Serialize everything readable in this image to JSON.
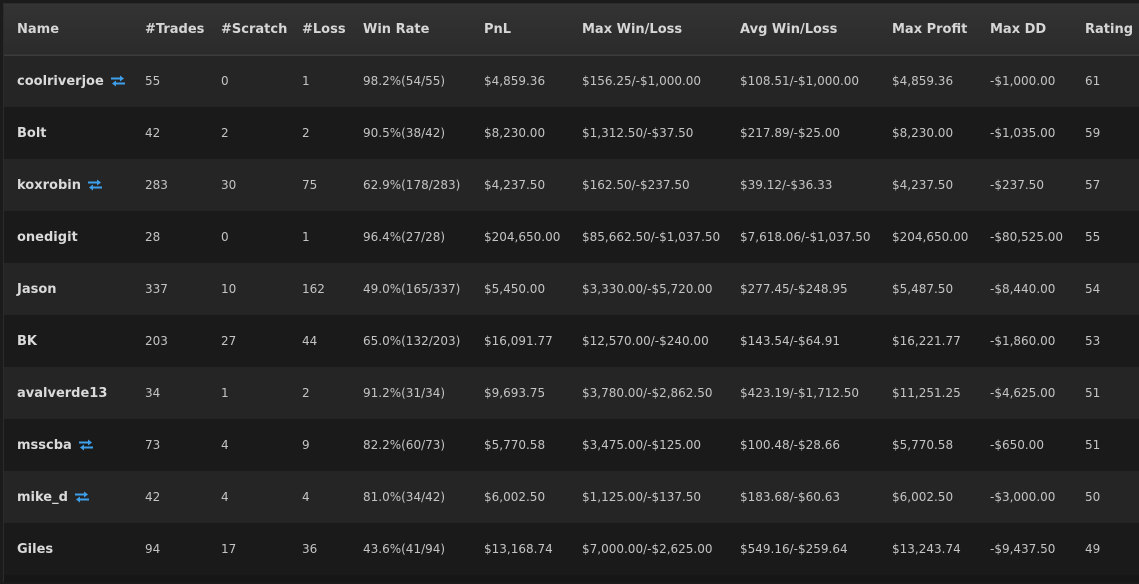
{
  "columns": [
    "Name",
    "#Trades",
    "#Scratch",
    "#Loss",
    "Win Rate",
    "PnL",
    "Max Win/Loss",
    "Avg Win/Loss",
    "Max Profit",
    "Max DD",
    "Rating"
  ],
  "rows": [
    {
      "name": "coolriverjoe",
      "swap": true,
      "trades": "55",
      "scratch": "0",
      "loss": "1",
      "win_rate": "98.2%(54/55)",
      "pnl": "$4,859.36",
      "max_win_loss": "$156.25/-$1,000.00",
      "avg_win_loss": "$108.51/-$1,000.00",
      "max_profit": "$4,859.36",
      "max_dd": "-$1,000.00",
      "rating": "61"
    },
    {
      "name": "Bolt",
      "swap": false,
      "trades": "42",
      "scratch": "2",
      "loss": "2",
      "win_rate": "90.5%(38/42)",
      "pnl": "$8,230.00",
      "max_win_loss": "$1,312.50/-$37.50",
      "avg_win_loss": "$217.89/-$25.00",
      "max_profit": "$8,230.00",
      "max_dd": "-$1,035.00",
      "rating": "59"
    },
    {
      "name": "koxrobin",
      "swap": true,
      "trades": "283",
      "scratch": "30",
      "loss": "75",
      "win_rate": "62.9%(178/283)",
      "pnl": "$4,237.50",
      "max_win_loss": "$162.50/-$237.50",
      "avg_win_loss": "$39.12/-$36.33",
      "max_profit": "$4,237.50",
      "max_dd": "-$237.50",
      "rating": "57"
    },
    {
      "name": "onedigit",
      "swap": false,
      "trades": "28",
      "scratch": "0",
      "loss": "1",
      "win_rate": "96.4%(27/28)",
      "pnl": "$204,650.00",
      "max_win_loss": "$85,662.50/-$1,037.50",
      "avg_win_loss": "$7,618.06/-$1,037.50",
      "max_profit": "$204,650.00",
      "max_dd": "-$80,525.00",
      "rating": "55"
    },
    {
      "name": "Jason",
      "swap": false,
      "trades": "337",
      "scratch": "10",
      "loss": "162",
      "win_rate": "49.0%(165/337)",
      "pnl": "$5,450.00",
      "max_win_loss": "$3,330.00/-$5,720.00",
      "avg_win_loss": "$277.45/-$248.95",
      "max_profit": "$5,487.50",
      "max_dd": "-$8,440.00",
      "rating": "54"
    },
    {
      "name": "BK",
      "swap": false,
      "trades": "203",
      "scratch": "27",
      "loss": "44",
      "win_rate": "65.0%(132/203)",
      "pnl": "$16,091.77",
      "max_win_loss": "$12,570.00/-$240.00",
      "avg_win_loss": "$143.54/-$64.91",
      "max_profit": "$16,221.77",
      "max_dd": "-$1,860.00",
      "rating": "53"
    },
    {
      "name": "avalverde13",
      "swap": false,
      "trades": "34",
      "scratch": "1",
      "loss": "2",
      "win_rate": "91.2%(31/34)",
      "pnl": "$9,693.75",
      "max_win_loss": "$3,780.00/-$2,862.50",
      "avg_win_loss": "$423.19/-$1,712.50",
      "max_profit": "$11,251.25",
      "max_dd": "-$4,625.00",
      "rating": "51"
    },
    {
      "name": "msscba",
      "swap": true,
      "trades": "73",
      "scratch": "4",
      "loss": "9",
      "win_rate": "82.2%(60/73)",
      "pnl": "$5,770.58",
      "max_win_loss": "$3,475.00/-$125.00",
      "avg_win_loss": "$100.48/-$28.66",
      "max_profit": "$5,770.58",
      "max_dd": "-$650.00",
      "rating": "51"
    },
    {
      "name": "mike_d",
      "swap": true,
      "trades": "42",
      "scratch": "4",
      "loss": "4",
      "win_rate": "81.0%(34/42)",
      "pnl": "$6,002.50",
      "max_win_loss": "$1,125.00/-$137.50",
      "avg_win_loss": "$183.68/-$60.63",
      "max_profit": "$6,002.50",
      "max_dd": "-$3,000.00",
      "rating": "50"
    },
    {
      "name": "Giles",
      "swap": false,
      "trades": "94",
      "scratch": "17",
      "loss": "36",
      "win_rate": "43.6%(41/94)",
      "pnl": "$13,168.74",
      "max_win_loss": "$7,000.00/-$2,625.00",
      "avg_win_loss": "$549.16/-$259.64",
      "max_profit": "$13,243.74",
      "max_dd": "-$9,437.50",
      "rating": "49"
    }
  ],
  "colors": {
    "swap_icon": "#3ea0ea",
    "header_bg": "#303030",
    "row_odd": "#252525",
    "row_even": "#1a1a1a"
  },
  "icons": {
    "swap": "swap-arrows-icon"
  }
}
